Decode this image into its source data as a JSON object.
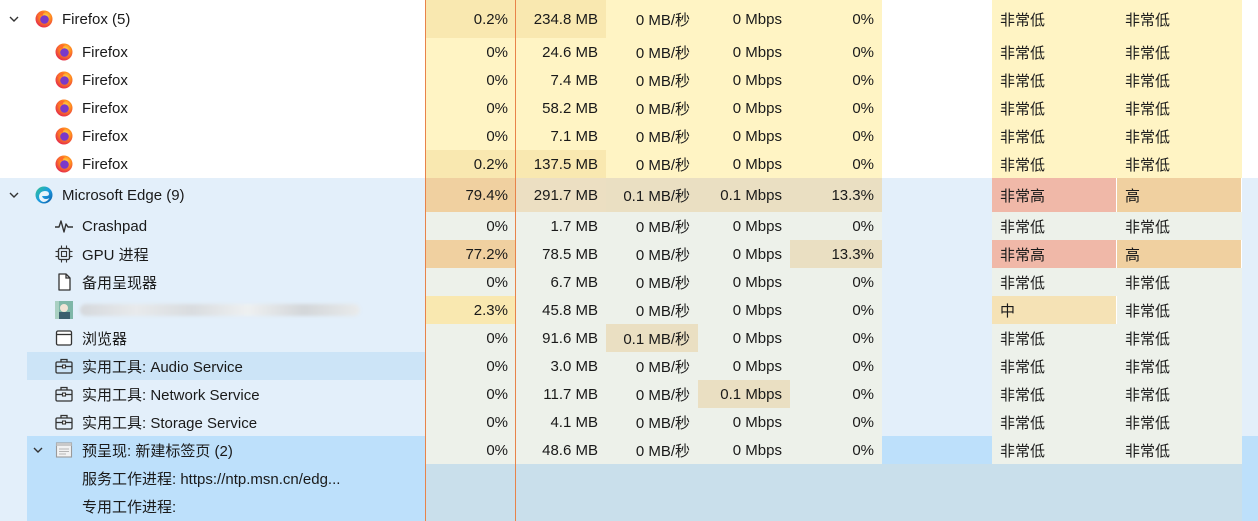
{
  "colors": {
    "name_bg_light": "#ffffff",
    "name_bg_edge": "#e3effa",
    "name_bg_selected": "#cce4f7",
    "name_bg_preview": "#bde0fb",
    "heat_0": "#fff4c4",
    "heat_1": "#f9e8b0",
    "heat_edge_0": "#edf1ea",
    "heat_high": "#f0d0a0",
    "heat_vhigh_status": "#f0b8a8",
    "col_divider": "#e8834a"
  },
  "rows": [
    {
      "name": "Firefox (5)",
      "chevron": "v",
      "icon": "firefox-icon",
      "indent": 0,
      "cpu": "0.2%",
      "mem": "234.8 MB",
      "disk": "0 MB/秒",
      "net": "0 Mbps",
      "gpu": "0%",
      "gpu_engine": "",
      "power": "非常低",
      "power_trend": "非常低"
    },
    {
      "name": "Firefox",
      "icon": "firefox-icon",
      "indent": 1,
      "cpu": "0%",
      "mem": "24.6 MB",
      "disk": "0 MB/秒",
      "net": "0 Mbps",
      "gpu": "0%",
      "gpu_engine": "",
      "power": "非常低",
      "power_trend": "非常低"
    },
    {
      "name": "Firefox",
      "icon": "firefox-icon",
      "indent": 1,
      "cpu": "0%",
      "mem": "7.4 MB",
      "disk": "0 MB/秒",
      "net": "0 Mbps",
      "gpu": "0%",
      "gpu_engine": "",
      "power": "非常低",
      "power_trend": "非常低"
    },
    {
      "name": "Firefox",
      "icon": "firefox-icon",
      "indent": 1,
      "cpu": "0%",
      "mem": "58.2 MB",
      "disk": "0 MB/秒",
      "net": "0 Mbps",
      "gpu": "0%",
      "gpu_engine": "",
      "power": "非常低",
      "power_trend": "非常低"
    },
    {
      "name": "Firefox",
      "icon": "firefox-icon",
      "indent": 1,
      "cpu": "0%",
      "mem": "7.1 MB",
      "disk": "0 MB/秒",
      "net": "0 Mbps",
      "gpu": "0%",
      "gpu_engine": "",
      "power": "非常低",
      "power_trend": "非常低"
    },
    {
      "name": "Firefox",
      "icon": "firefox-icon",
      "indent": 1,
      "cpu": "0.2%",
      "mem": "137.5 MB",
      "disk": "0 MB/秒",
      "net": "0 Mbps",
      "gpu": "0%",
      "gpu_engine": "",
      "power": "非常低",
      "power_trend": "非常低"
    },
    {
      "name": "Microsoft Edge (9)",
      "chevron": "v",
      "icon": "edge-icon",
      "indent": 0,
      "cpu": "79.4%",
      "mem": "291.7 MB",
      "disk": "0.1 MB/秒",
      "net": "0.1 Mbps",
      "gpu": "13.3%",
      "gpu_engine": "",
      "power": "非常高",
      "power_trend": "高"
    },
    {
      "name": "Crashpad",
      "icon": "pulse-icon",
      "indent": 1,
      "cpu": "0%",
      "mem": "1.7 MB",
      "disk": "0 MB/秒",
      "net": "0 Mbps",
      "gpu": "0%",
      "gpu_engine": "",
      "power": "非常低",
      "power_trend": "非常低"
    },
    {
      "name": "GPU 进程",
      "icon": "chip-icon",
      "indent": 1,
      "cpu": "77.2%",
      "mem": "78.5 MB",
      "disk": "0 MB/秒",
      "net": "0 Mbps",
      "gpu": "13.3%",
      "gpu_engine": "",
      "power": "非常高",
      "power_trend": "高"
    },
    {
      "name": "备用呈现器",
      "icon": "page-icon",
      "indent": 1,
      "cpu": "0%",
      "mem": "6.7 MB",
      "disk": "0 MB/秒",
      "net": "0 Mbps",
      "gpu": "0%",
      "gpu_engine": "",
      "power": "非常低",
      "power_trend": "非常低"
    },
    {
      "name": "",
      "icon": "thumbnail-icon",
      "indent": 1,
      "blurred": true,
      "cpu": "2.3%",
      "mem": "45.8 MB",
      "disk": "0 MB/秒",
      "net": "0 Mbps",
      "gpu": "0%",
      "gpu_engine": "",
      "power": "中",
      "power_trend": "非常低"
    },
    {
      "name": "浏览器",
      "icon": "window-icon",
      "indent": 1,
      "cpu": "0%",
      "mem": "91.6 MB",
      "disk": "0.1 MB/秒",
      "net": "0 Mbps",
      "gpu": "0%",
      "gpu_engine": "",
      "power": "非常低",
      "power_trend": "非常低"
    },
    {
      "name": "实用工具: Audio Service",
      "icon": "toolbox-icon",
      "indent": 1,
      "selected": true,
      "cpu": "0%",
      "mem": "3.0 MB",
      "disk": "0 MB/秒",
      "net": "0 Mbps",
      "gpu": "0%",
      "gpu_engine": "",
      "power": "非常低",
      "power_trend": "非常低"
    },
    {
      "name": "实用工具: Network Service",
      "icon": "toolbox-icon",
      "indent": 1,
      "cpu": "0%",
      "mem": "11.7 MB",
      "disk": "0 MB/秒",
      "net": "0.1 Mbps",
      "gpu": "0%",
      "gpu_engine": "",
      "power": "非常低",
      "power_trend": "非常低"
    },
    {
      "name": "实用工具: Storage Service",
      "icon": "toolbox-icon",
      "indent": 1,
      "cpu": "0%",
      "mem": "4.1 MB",
      "disk": "0 MB/秒",
      "net": "0 Mbps",
      "gpu": "0%",
      "gpu_engine": "",
      "power": "非常低",
      "power_trend": "非常低"
    },
    {
      "name": "预呈现: 新建标签页 (2)",
      "chevron": "v",
      "icon": "tab-page-icon",
      "indent": 1,
      "preview": true,
      "cpu": "0%",
      "mem": "48.6 MB",
      "disk": "0 MB/秒",
      "net": "0 Mbps",
      "gpu": "0%",
      "gpu_engine": "",
      "power": "非常低",
      "power_trend": "非常低"
    },
    {
      "name": "服务工作进程: https://ntp.msn.cn/edg...",
      "indent": 2,
      "preview_child": true,
      "cpu": "",
      "mem": "",
      "disk": "",
      "net": "",
      "gpu": "",
      "gpu_engine": "",
      "power": "",
      "power_trend": ""
    },
    {
      "name": "专用工作进程:",
      "indent": 2,
      "preview_child": true,
      "cpu": "",
      "mem": "",
      "disk": "",
      "net": "",
      "gpu": "",
      "gpu_engine": "",
      "power": "",
      "power_trend": ""
    }
  ]
}
